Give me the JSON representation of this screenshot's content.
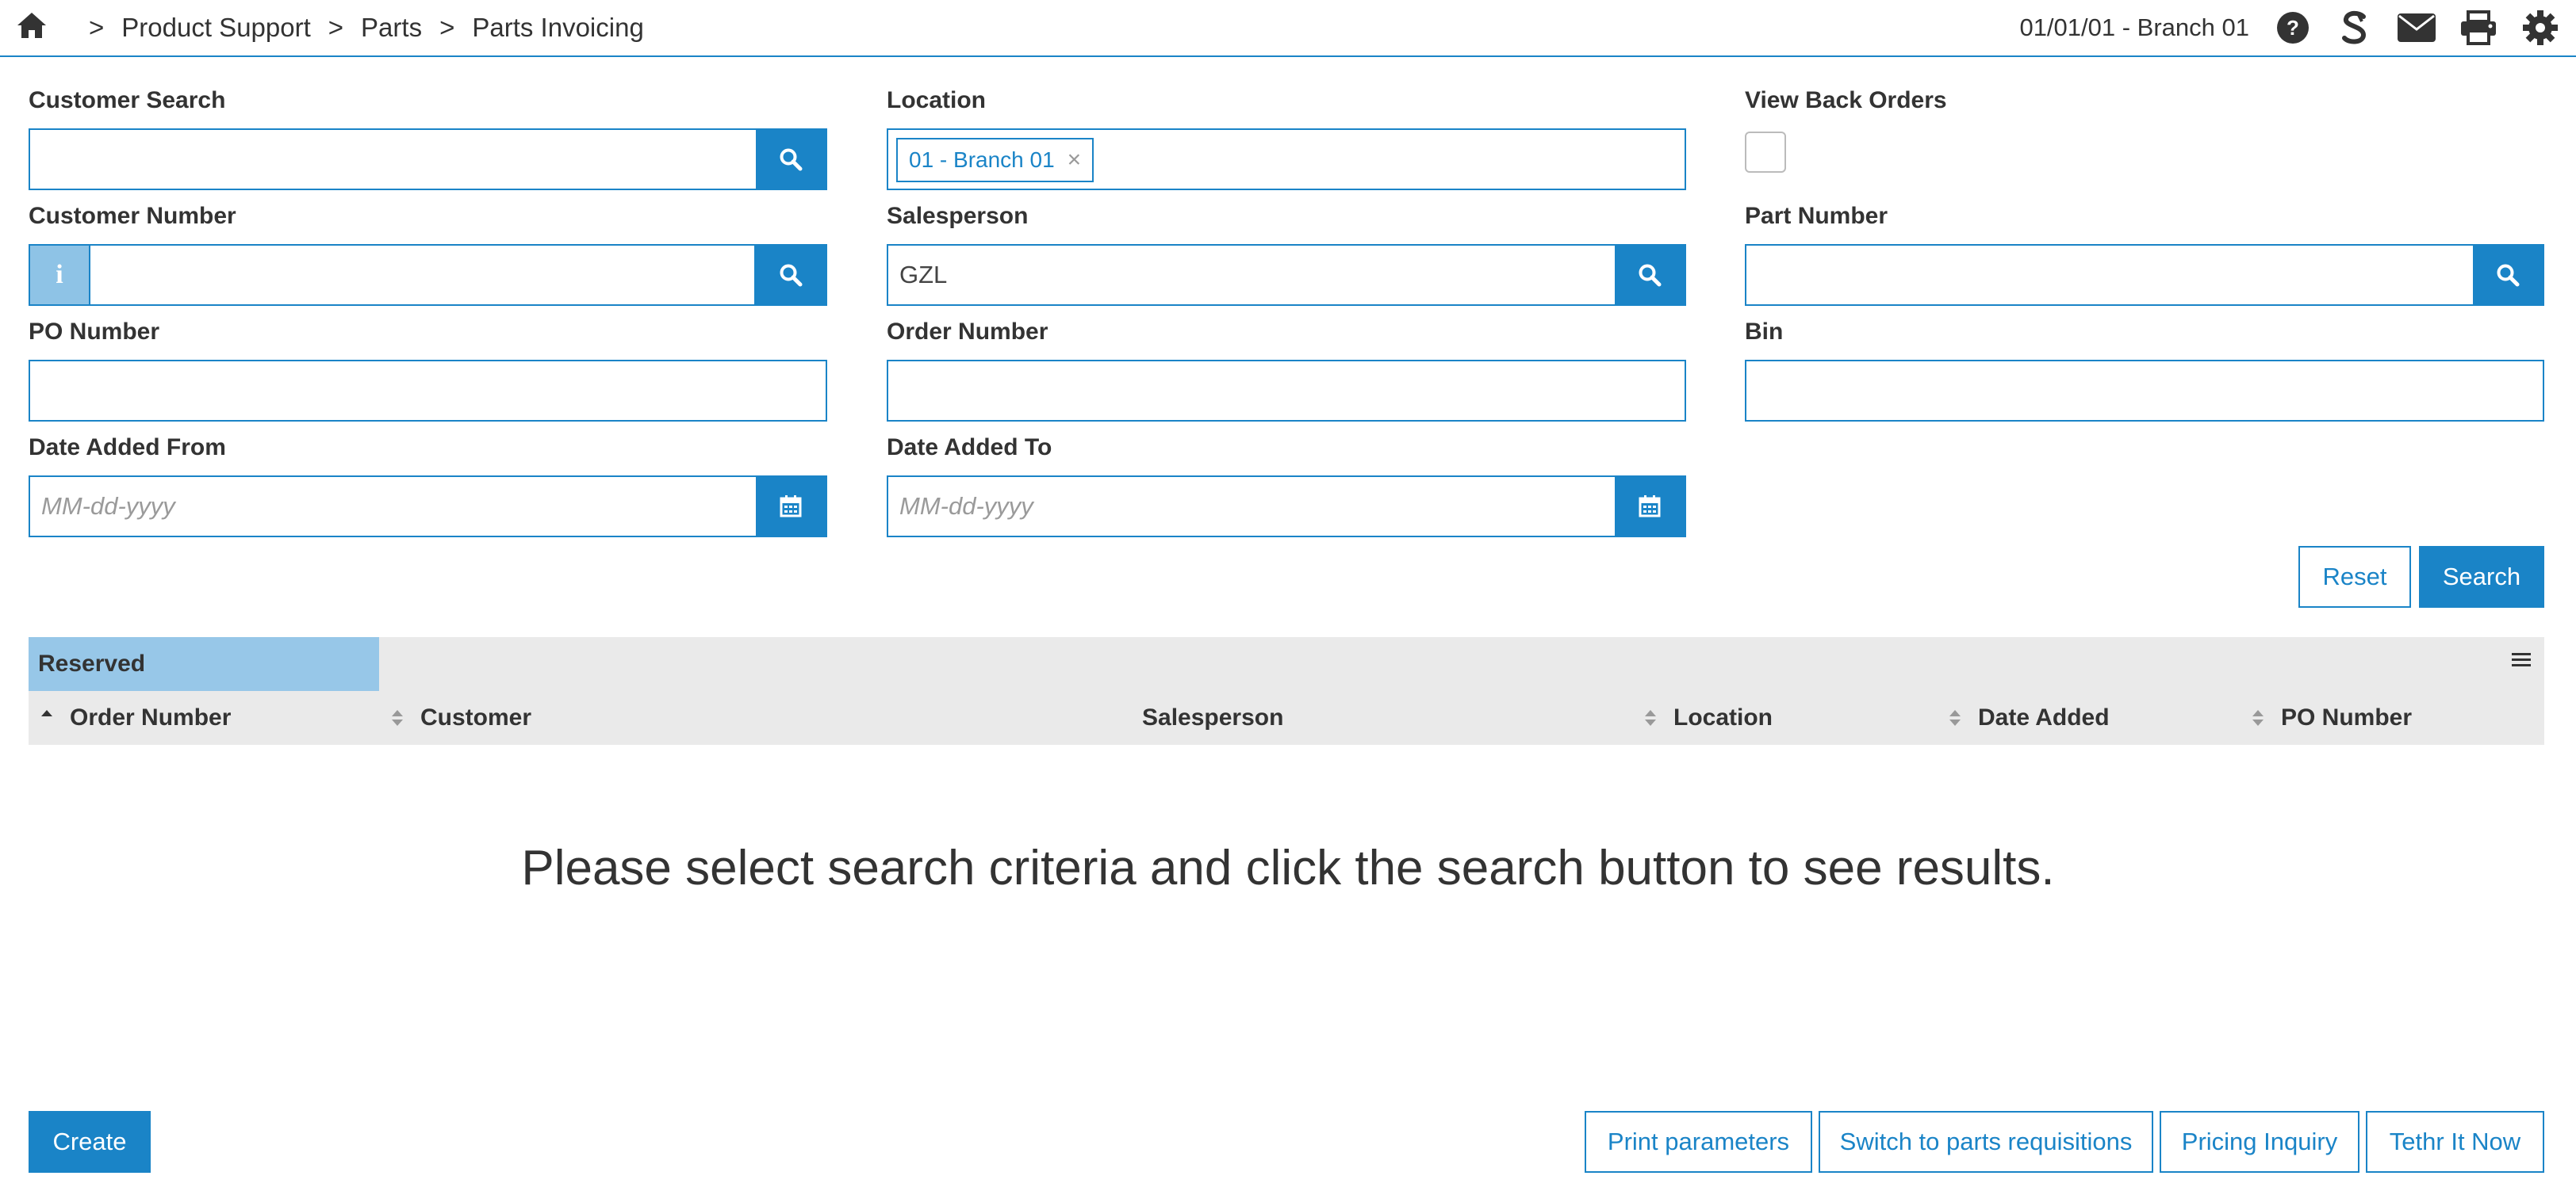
{
  "breadcrumb": {
    "separator": ">",
    "items": [
      "Product Support",
      "Parts",
      "Parts Invoicing"
    ]
  },
  "header": {
    "date_branch": "01/01/01 - Branch 01",
    "icons": [
      "help-icon",
      "s-logo-icon",
      "envelope-icon",
      "print-icon",
      "gear-icon"
    ]
  },
  "form": {
    "customer_search": {
      "label": "Customer Search",
      "value": ""
    },
    "location": {
      "label": "Location",
      "tag": "01 - Branch 01",
      "tag_remove": "×"
    },
    "view_back_orders": {
      "label": "View Back Orders",
      "checked": false
    },
    "customer_number": {
      "label": "Customer Number",
      "info": "i",
      "value": ""
    },
    "salesperson": {
      "label": "Salesperson",
      "value": "GZL"
    },
    "part_number": {
      "label": "Part Number",
      "value": ""
    },
    "po_number": {
      "label": "PO Number",
      "value": ""
    },
    "order_number": {
      "label": "Order Number",
      "value": ""
    },
    "bin": {
      "label": "Bin",
      "value": ""
    },
    "date_added_from": {
      "label": "Date Added From",
      "placeholder": "MM-dd-yyyy"
    },
    "date_added_to": {
      "label": "Date Added To",
      "placeholder": "MM-dd-yyyy"
    },
    "reset_label": "Reset",
    "search_label": "Search"
  },
  "grid": {
    "tab": "Reserved",
    "columns": [
      "Order Number",
      "Customer",
      "Salesperson",
      "Location",
      "Date Added",
      "PO Number"
    ],
    "empty_message": "Please select search criteria and click the search button to see results."
  },
  "footer": {
    "create_label": "Create",
    "buttons": [
      "Print parameters",
      "Switch to parts requisitions",
      "Pricing Inquiry",
      "Tethr It Now"
    ]
  },
  "colors": {
    "accent": "#1a84c7",
    "addon_light": "#8ec3e6",
    "tab_bg": "#97c7e8",
    "grid_header_bg": "#eaeaea"
  }
}
